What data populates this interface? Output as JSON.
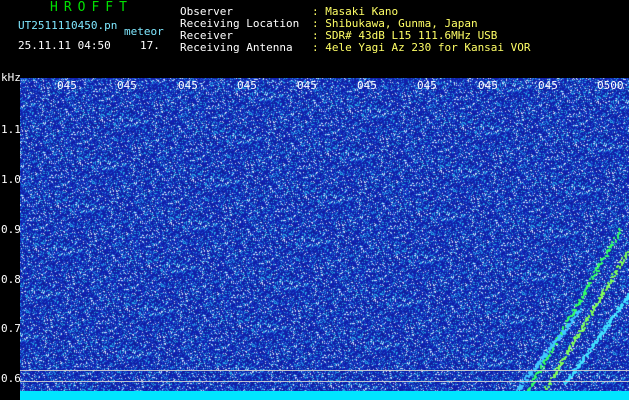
{
  "header": {
    "logo": "HROFFT",
    "file_name": "UT2511110450.pn",
    "meteor_label": "meteor",
    "date_time": "25.11.11 04:50",
    "count": "17.",
    "fields": [
      {
        "label": "Observer",
        "value": ": Masaki Kano"
      },
      {
        "label": "Receiving Location",
        "value": ": Shibukawa, Gunma, Japan"
      },
      {
        "label": "Receiver",
        "value": ": SDR# 43dB L15 111.6MHz USB"
      },
      {
        "label": "Receiving Antenna",
        "value": ": 4ele Yagi Az 230 for Kansai VOR"
      }
    ]
  },
  "time_ticks": [
    "045",
    "045",
    "045",
    "045",
    "045",
    "045",
    "045",
    "045",
    "045",
    "0500"
  ],
  "freq_axis": {
    "unit": "kHz",
    "ticks": [
      "1.1",
      "1.0",
      "0.9",
      "0.8",
      "0.7",
      "0.6"
    ]
  },
  "colors": {
    "background": "#000000",
    "spectrogram_base": "#1a2fa8",
    "baseline": "#00e5ff",
    "logo": "#00e000"
  }
}
